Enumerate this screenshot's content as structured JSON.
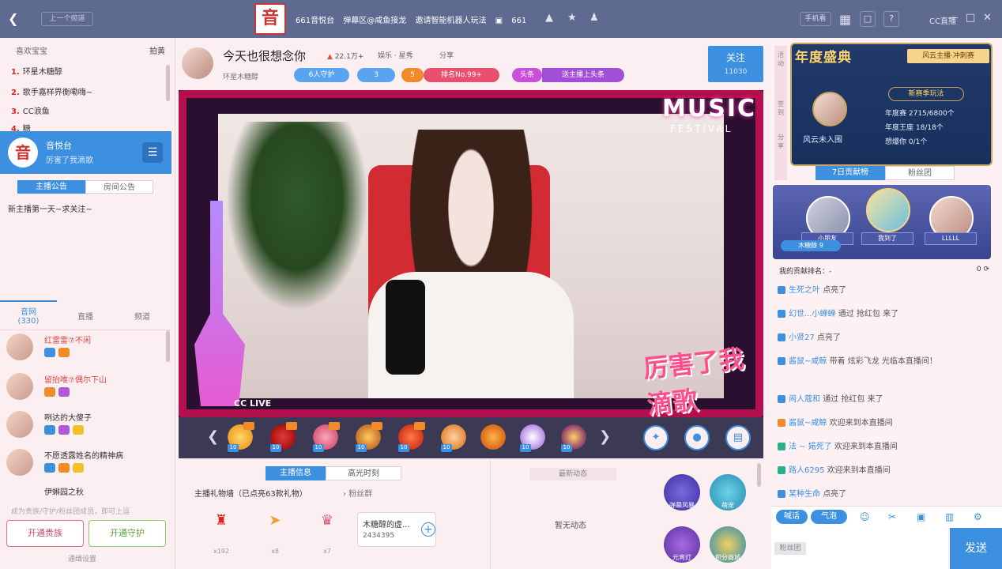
{
  "topbar": {
    "prev_label": "上一个频道",
    "logo_char": "音",
    "room_id": "661音悦台",
    "danmu": "弹幕区@咸鱼接龙",
    "invite": "邀请智能机器人玩法",
    "online": "661",
    "mobile": "手机看",
    "cc_logo": "CC直播"
  },
  "left": {
    "header": "喜欢宝宝",
    "header_right": "拍黄",
    "ranks": [
      {
        "n": "1.",
        "name": "环星木糖醇"
      },
      {
        "n": "2.",
        "name": "歌手嘉样界衡嘞嗨~"
      },
      {
        "n": "3.",
        "name": "CC浪鱼"
      },
      {
        "n": "4.",
        "name": "糖"
      }
    ],
    "channel_name": "音悦台",
    "channel_sub": "厉害了我滴歌",
    "tab_host": "主播公告",
    "tab_room": "房间公告",
    "notice": "新主播第一天~求关注~",
    "aud_tab": "音网",
    "aud_count": "(330)",
    "tab_live": "直播",
    "tab_channel": "频道",
    "audience": [
      {
        "name": "红雷雷⑦不闲",
        "color": "#e04545"
      },
      {
        "name": "留抬唯⑦偶尔下山",
        "color": "#e04545"
      },
      {
        "name": "咧达的大傻子",
        "color": "#333333"
      },
      {
        "name": "不愿透露姓名的精神病",
        "color": "#333333"
      },
      {
        "name": "伊蝌园之秋",
        "color": "#333333"
      }
    ],
    "hint": "成为贵族/守护/粉丝团成员，即可上逗",
    "btn_noble": "开通贵族",
    "btn_guard": "开通守护",
    "settings": "通缉设置"
  },
  "center": {
    "room_title": "今天也很想念你",
    "heat": "22.1万+",
    "category": "娱乐 · 星秀",
    "share": "分享",
    "host_name": "环星木糖醇",
    "guard": "6人守护",
    "fans": "3",
    "level": "5",
    "rank": "排名No.99+",
    "headline": "头条",
    "headline_text": "送主播上头条",
    "follow": "关注",
    "follow_count": "11030",
    "video_music": "MUSIC",
    "video_festival": "FESTIVAL",
    "video_lyric": "厉害了我滴歌",
    "video_cclive": "CC LIVE",
    "tab_host_info": "主播信息",
    "tab_highlight": "高光时刻",
    "fan_list": "主播礼物墙（已点亮63款礼物）",
    "fan_group": "粉丝群",
    "group_name": "木糖醇的虚...",
    "group_id": "2434395",
    "dynamic": "最新动态",
    "no_dynamic": "暂无动态",
    "gift_counts": [
      "x192",
      "x8",
      "x7"
    ],
    "gift_badge": "10"
  },
  "plays": [
    "弹幕风暴",
    "萌宠",
    "元宵灯",
    "积分商城"
  ],
  "right": {
    "side_tabs": [
      "活动",
      "签到",
      "分享"
    ],
    "ann_title": "年度盛典",
    "ann_badge": "风云主播·冲刺赛",
    "ann_name": "风云未入围",
    "ann_new": "新赛季玩法",
    "ann_rows": [
      "年度赛 2715/6800个",
      "年度王座 18/18个",
      "想爆你 0/1个"
    ],
    "tab_week": "7日贡献榜",
    "tab_fans": "粉丝团",
    "podium": [
      "小朋友",
      "我到了",
      "LLLLL"
    ],
    "crown": "木糖醇 9",
    "my_rank": "我的贡献排名：-",
    "my_rank_val": "0",
    "messages": [
      {
        "u": "生死之叶",
        "t": "点亮了"
      },
      {
        "u": "幻世...小蝉蝉",
        "t": "通过 抢红包 来了"
      },
      {
        "u": "小贤27",
        "t": "点亮了"
      },
      {
        "u": "酱鼠~咸鲸",
        "t": "带着 炫彩飞龙 光临本直播间！"
      },
      {
        "u": "闹人蔻和",
        "t": "通过 抢红包 来了"
      },
      {
        "u": "酱鼠~咸鲸",
        "t": "欢迎来到本直播间"
      },
      {
        "u": "法 ~ 婼死了",
        "t": "欢迎来到本直播间"
      },
      {
        "u": "路人6295",
        "t": "欢迎来到本直播间"
      },
      {
        "u": "某种生命",
        "t": "点亮了"
      }
    ],
    "tab_chat": "喊话",
    "tab_gas": "气泡",
    "fans_btn": "粉丝团",
    "send": "发送"
  },
  "colors": {
    "accent": "#3d8fe0",
    "topbar": "#5e6a8f",
    "video_frame": "#b4104e"
  }
}
